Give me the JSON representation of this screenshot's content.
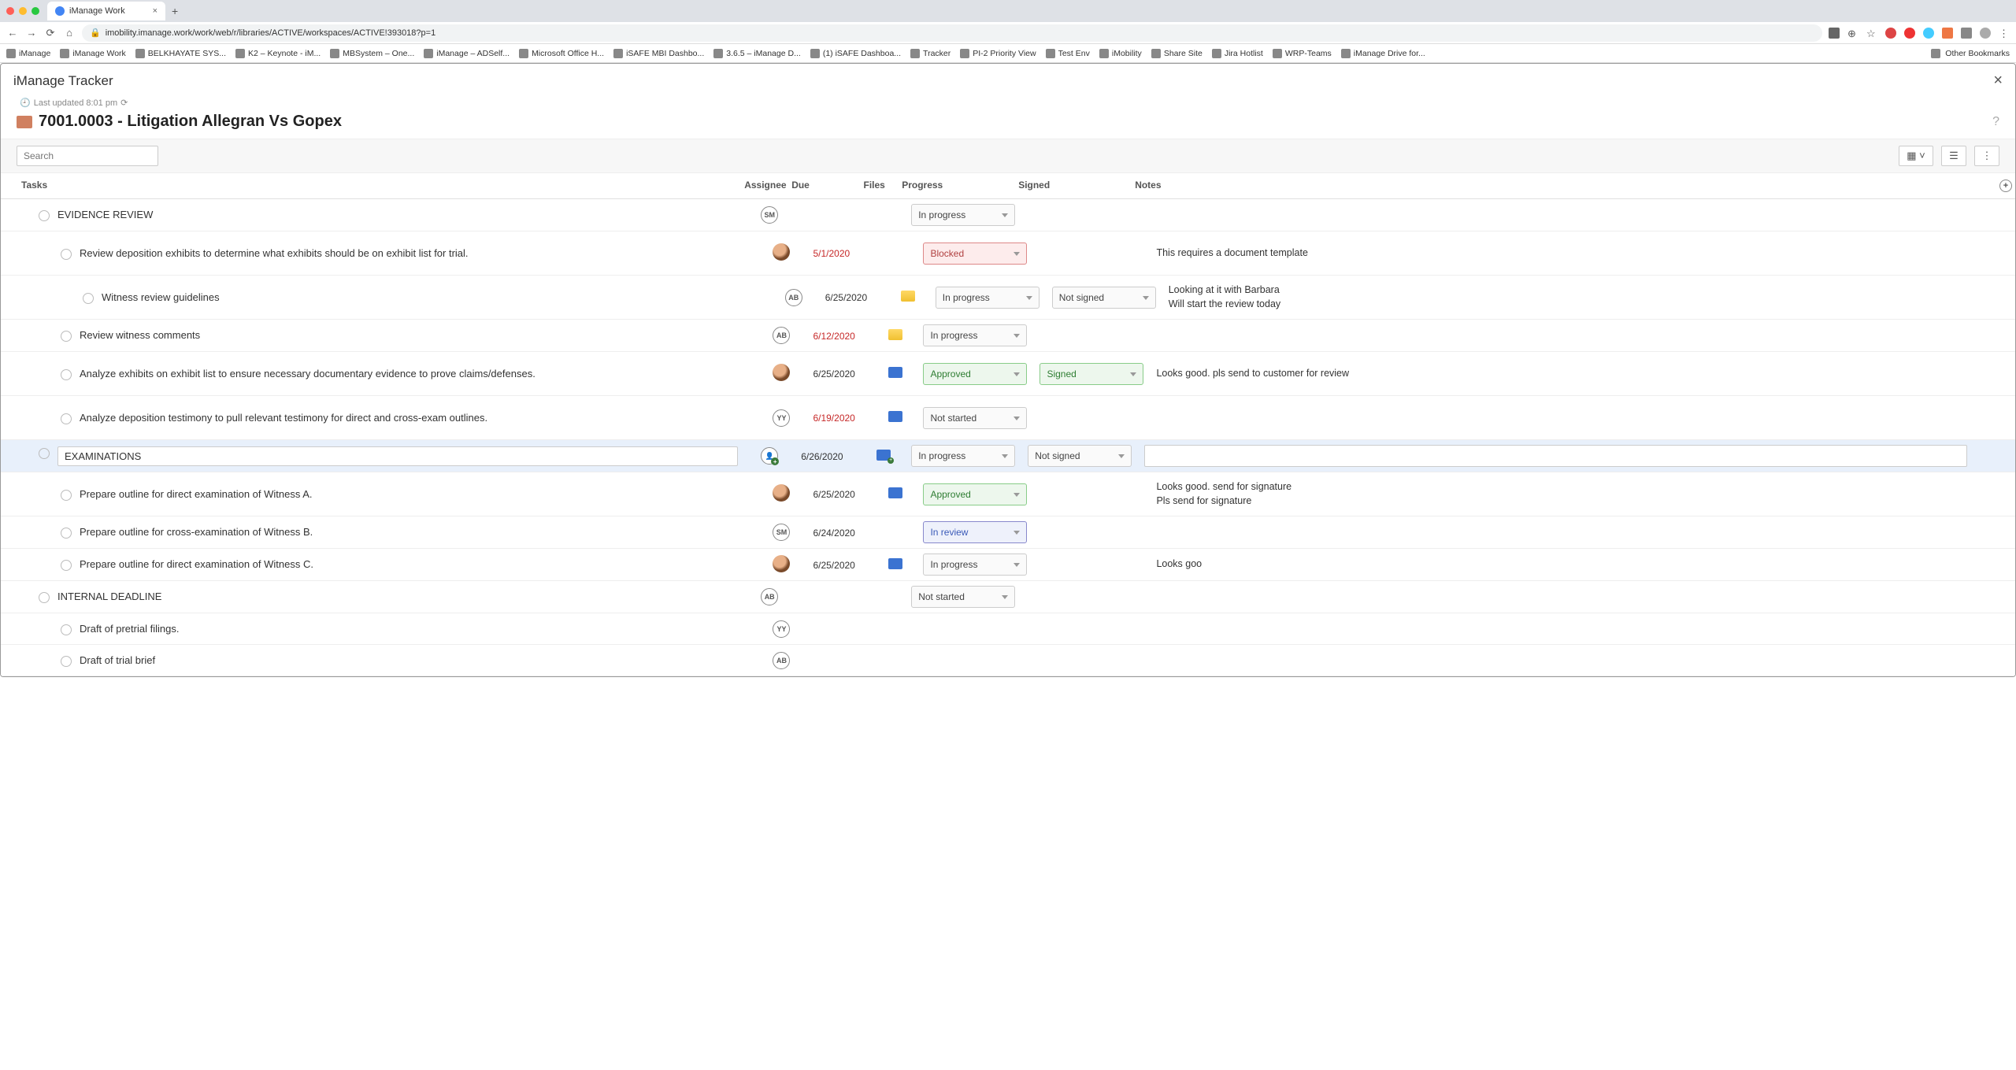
{
  "browser": {
    "tab_title": "iManage Work",
    "url": "imobility.imanage.work/work/web/r/libraries/ACTIVE/workspaces/ACTIVE!393018?p=1",
    "bookmarks": [
      "iManage",
      "iManage Work",
      "BELKHAYATE SYS...",
      "K2 – Keynote - iM...",
      "MBSystem – One...",
      "iManage – ADSelf...",
      "Microsoft Office H...",
      "iSAFE MBI Dashbo...",
      "3.6.5 – iManage D...",
      "(1) iSAFE Dashboa...",
      "Tracker",
      "PI-2 Priority View",
      "Test Env",
      "iMobility",
      "Share Site",
      "Jira Hotlist",
      "WRP-Teams",
      "iManage Drive for..."
    ],
    "other_bookmarks": "Other Bookmarks"
  },
  "app": {
    "title": "iManage Tracker",
    "last_updated": "Last updated 8:01 pm",
    "workspace": "7001.0003 - Litigation Allegran Vs Gopex",
    "search_placeholder": "Search"
  },
  "columns": {
    "tasks": "Tasks",
    "assignee": "Assignee",
    "due": "Due",
    "files": "Files",
    "progress": "Progress",
    "signed": "Signed",
    "notes": "Notes"
  },
  "rows": [
    {
      "indent": 0,
      "title": "EVIDENCE REVIEW",
      "avatar": "SM",
      "progress": "In progress"
    },
    {
      "indent": 1,
      "tall": true,
      "title": "Review deposition exhibits to determine what exhibits should be on exhibit list for trial.",
      "avatar": "img",
      "due": "5/1/2020",
      "due_red": true,
      "progress": "Blocked",
      "progress_style": "red",
      "notes": "This requires a document template"
    },
    {
      "indent": 2,
      "tall": true,
      "title": "Witness review guidelines",
      "avatar": "AB",
      "due": "6/25/2020",
      "file": "email",
      "progress": "In progress",
      "signed": "Not signed",
      "notes": "Looking at it with Barbara\nWill start the review today"
    },
    {
      "indent": 1,
      "title": "Review witness comments",
      "avatar": "AB",
      "due": "6/12/2020",
      "due_red": true,
      "file": "email",
      "progress": "In progress"
    },
    {
      "indent": 1,
      "tall": true,
      "title": "Analyze exhibits on exhibit list to ensure necessary documentary evidence to prove claims/defenses.",
      "avatar": "img",
      "due": "6/25/2020",
      "file": "doc",
      "progress": "Approved",
      "progress_style": "green",
      "signed": "Signed",
      "signed_style": "green",
      "notes": "Looks good. pls send to customer for review"
    },
    {
      "indent": 1,
      "tall": true,
      "title": "Analyze deposition testimony to pull relevant testimony for direct and cross-exam outlines.",
      "avatar": "YY",
      "due": "6/19/2020",
      "due_red": true,
      "file": "doc",
      "progress": "Not started"
    },
    {
      "indent": 0,
      "selected": true,
      "boxed": true,
      "title": "EXAMINATIONS",
      "avatar": "plus",
      "due": "6/26/2020",
      "file": "docp",
      "progress": "In progress",
      "signed": "Not signed",
      "notes_input": true
    },
    {
      "indent": 1,
      "tall": true,
      "title": "Prepare outline for direct examination of Witness A.",
      "avatar": "img",
      "due": "6/25/2020",
      "file": "doc",
      "progress": "Approved",
      "progress_style": "green",
      "notes": "Looks good. send for signature\nPls send for signature"
    },
    {
      "indent": 1,
      "title": "Prepare outline for cross-examination of Witness B.",
      "avatar": "SM",
      "due": "6/24/2020",
      "progress": "In review",
      "progress_style": "blue"
    },
    {
      "indent": 1,
      "title": "Prepare outline for direct examination of Witness C.",
      "avatar": "img",
      "due": "6/25/2020",
      "file": "doc",
      "progress": "In progress",
      "notes": "Looks goo"
    },
    {
      "indent": 0,
      "title": "INTERNAL DEADLINE",
      "avatar": "AB",
      "progress": "Not started"
    },
    {
      "indent": 1,
      "title": "Draft of pretrial filings.",
      "avatar": "YY"
    },
    {
      "indent": 1,
      "title": "Draft of trial brief",
      "avatar": "AB"
    }
  ]
}
